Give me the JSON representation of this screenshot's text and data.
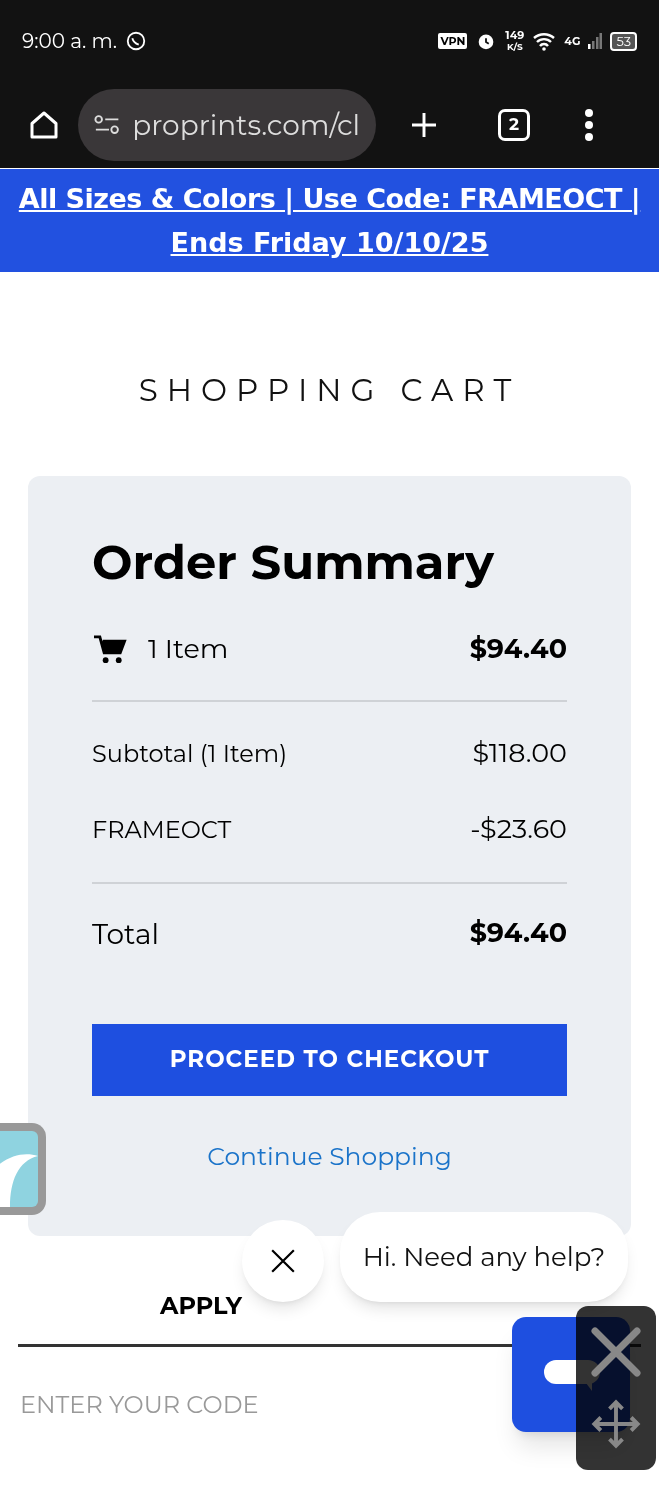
{
  "status_bar": {
    "time": "9:00 a. m.",
    "vpn": "VPN",
    "speed_value": "149",
    "speed_unit": "K/S",
    "network": "4G",
    "battery": "53"
  },
  "browser": {
    "url": "proprints.com/cl",
    "tab_count": "2"
  },
  "banner": {
    "line_1": "All Sizes & Colors | Use Code: FRAMEOCT |",
    "line_2": "Ends Friday 10/10/25"
  },
  "page_title": "SHOPPING CART",
  "order_summary": {
    "title": "Order Summary",
    "item_count": "1 Item",
    "item_total": "$94.40",
    "lines": [
      {
        "label": "Subtotal (1 Item)",
        "value": "$118.00"
      },
      {
        "label": "FRAMEOCT",
        "value": "-$23.60"
      }
    ],
    "total_label": "Total",
    "total_value": "$94.40",
    "checkout_button": "PROCEED TO CHECKOUT",
    "continue_link": "Continue Shopping"
  },
  "discount": {
    "heading": "APPLY",
    "placeholder": "ENTER YOUR CODE"
  },
  "chat": {
    "message": "Hi. Need any help?"
  }
}
